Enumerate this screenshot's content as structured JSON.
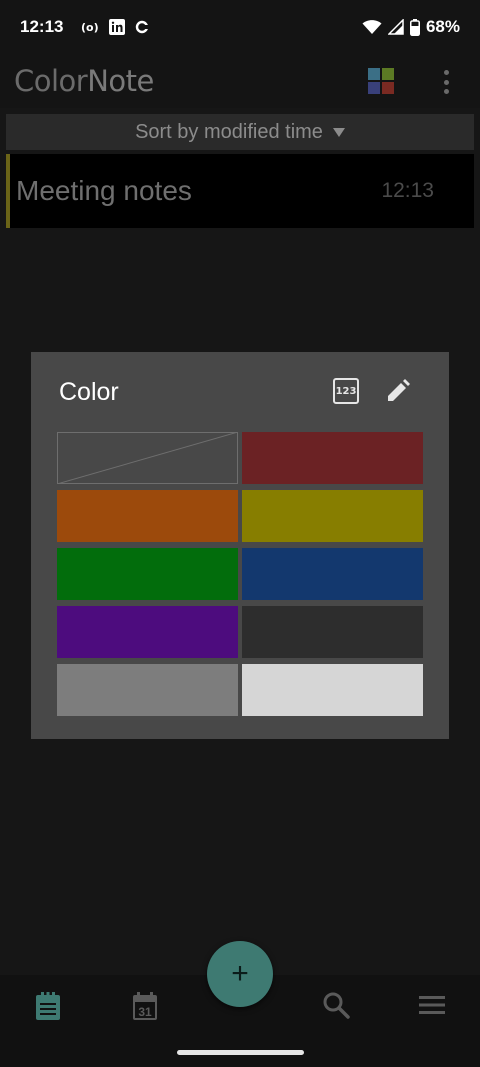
{
  "status_bar": {
    "time": "12:13",
    "battery": "68%",
    "icons": [
      "hotspot-icon",
      "linkedin-icon",
      "sync-icon",
      "wifi-icon",
      "signal-icon",
      "battery-icon"
    ]
  },
  "app": {
    "brand_part1": "Color",
    "brand_part2": "Note",
    "icons": [
      "view-grid-icon",
      "more-vert-icon"
    ]
  },
  "sort": {
    "label": "Sort by modified time"
  },
  "notes": [
    {
      "title": "Meeting notes",
      "time": "12:13",
      "color": "#6b6418"
    }
  ],
  "dialog": {
    "title": "Color",
    "icons": [
      "number-123-icon",
      "edit-pencil-icon"
    ],
    "swatches": [
      {
        "name": "none",
        "color": "#4b4b4b"
      },
      {
        "name": "red",
        "color": "#6b2224"
      },
      {
        "name": "orange",
        "color": "#9c4a0c"
      },
      {
        "name": "yellow",
        "color": "#877e00"
      },
      {
        "name": "green",
        "color": "#026d0c"
      },
      {
        "name": "blue",
        "color": "#13386e"
      },
      {
        "name": "purple",
        "color": "#4d0c7e"
      },
      {
        "name": "black",
        "color": "#2d2d2d"
      },
      {
        "name": "gray",
        "color": "#7d7d7d"
      },
      {
        "name": "white",
        "color": "#d6d6d6"
      }
    ]
  },
  "bottom_nav": {
    "calendar_day": "31",
    "items": [
      "notes-icon",
      "calendar-icon",
      "add-icon",
      "search-icon",
      "menu-icon"
    ],
    "fab_label": "+"
  },
  "colors": {
    "accent": "#3e7a72",
    "background": "#161616"
  }
}
